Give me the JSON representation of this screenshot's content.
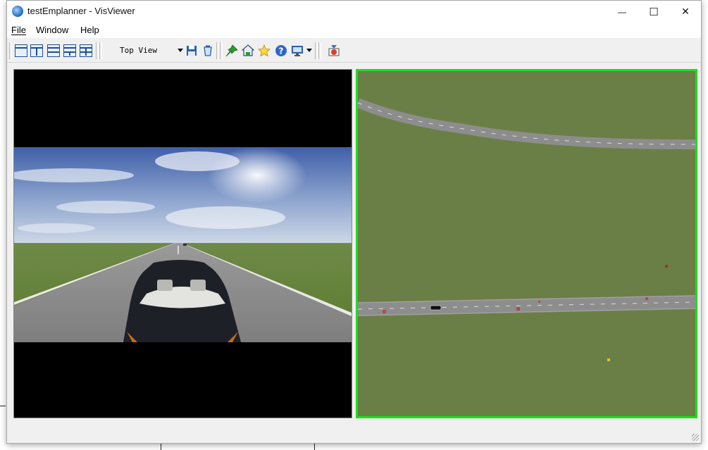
{
  "window": {
    "title": "testEmplanner - VisViewer",
    "controls": {
      "minimize": "—",
      "maximize": "☐",
      "close": "✕"
    }
  },
  "menu": [
    {
      "label": "File",
      "mnemonic": "F"
    },
    {
      "label": "Window",
      "mnemonic": "W"
    },
    {
      "label": "Help",
      "mnemonic": "H"
    }
  ],
  "toolbar": {
    "layout_buttons": [
      "single-view",
      "two-columns",
      "two-rows",
      "three-views",
      "four-views"
    ],
    "view_select": {
      "selected": "Top View"
    },
    "action_icons": [
      "save-icon",
      "clear-icon",
      "pin-icon",
      "home-icon",
      "star-icon",
      "help-icon",
      "monitor-icon",
      "record-icon"
    ]
  },
  "views": {
    "left": {
      "name": "camera-view",
      "content": "follow camera behind black convertible on road under blue cloudy sky"
    },
    "right": {
      "name": "top-view",
      "content": "top-down map of two grey roads on green terrain",
      "selected_border_color": "#1ae01a"
    }
  },
  "colors": {
    "grass": "#6a7f45",
    "road": "#8a8a8a",
    "selection": "#1ae01a",
    "sky_top": "#3f5fa8",
    "sky_bottom": "#cfd8e6"
  }
}
